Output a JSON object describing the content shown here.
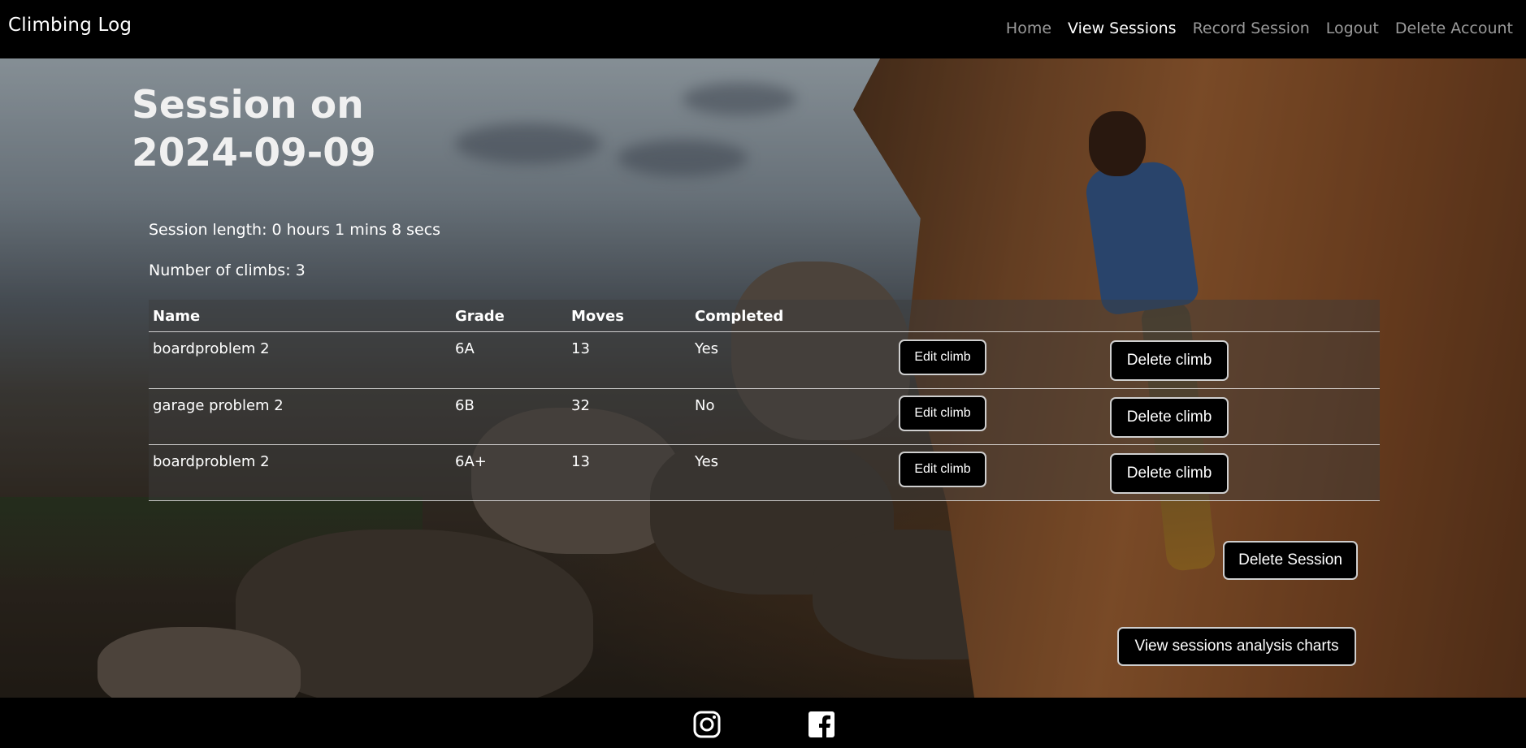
{
  "nav": {
    "brand": "Climbing Log",
    "links": [
      "Home",
      "View Sessions",
      "Record Session",
      "Logout",
      "Delete Account"
    ],
    "active": "View Sessions"
  },
  "session": {
    "title": "Session on 2024-09-09",
    "length": "Session length: 0 hours 1 mins 8 secs",
    "count": "Number of climbs: 3"
  },
  "table": {
    "headers": [
      "Name",
      "Grade",
      "Moves",
      "Completed"
    ],
    "rows": [
      {
        "name": "boardproblem 2",
        "grade": "6A",
        "moves": "13",
        "completed": "Yes"
      },
      {
        "name": "garage problem 2",
        "grade": "6B",
        "moves": "32",
        "completed": "No"
      },
      {
        "name": "boardproblem 2",
        "grade": "6A+",
        "moves": "13",
        "completed": "Yes"
      }
    ],
    "edit_label": "Edit climb",
    "delete_label": "Delete climb"
  },
  "actions": {
    "delete_session": "Delete Session",
    "view_charts": "View sessions analysis charts"
  },
  "footer": {
    "icons": [
      "instagram-icon",
      "facebook-icon"
    ]
  }
}
